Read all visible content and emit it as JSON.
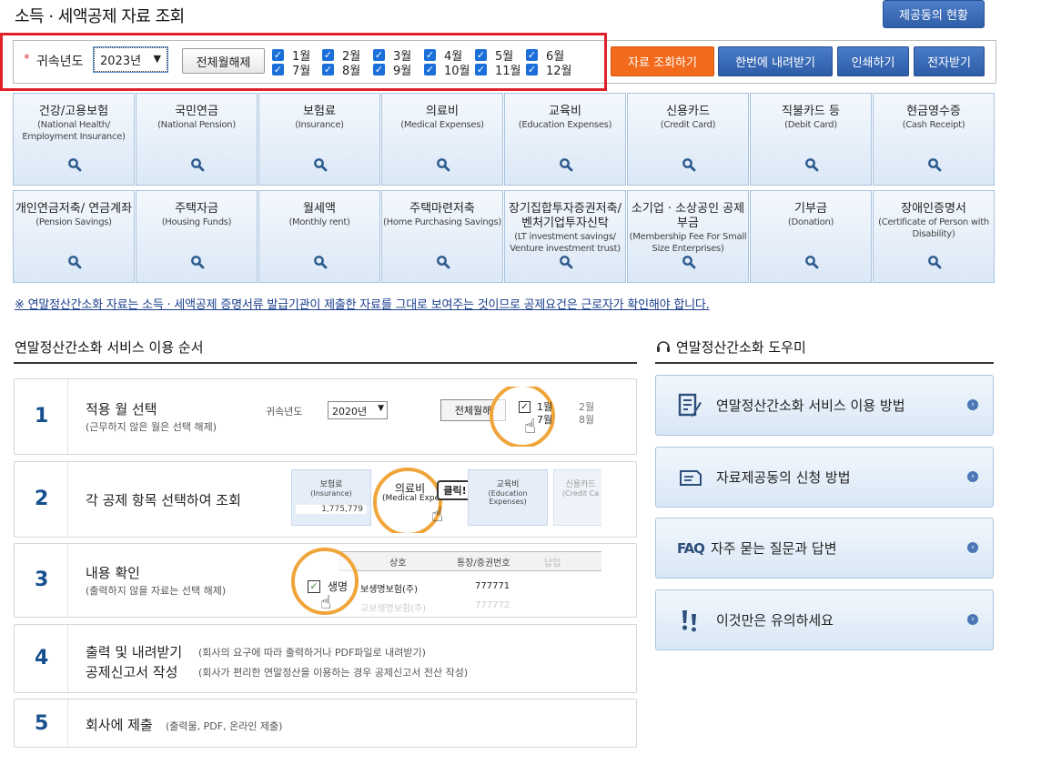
{
  "header": {
    "title": "소득 · 세액공제 자료 조회",
    "status_button": "제공동의 현황"
  },
  "filter": {
    "required_mark": "*",
    "year_label": "귀속년도",
    "year_value": "2023년",
    "uncheck_all": "전체월해제",
    "months": [
      "1월",
      "2월",
      "3월",
      "4월",
      "5월",
      "6월",
      "7월",
      "8월",
      "9월",
      "10월",
      "11월",
      "12월"
    ],
    "checked": [
      true,
      true,
      true,
      true,
      true,
      true,
      true,
      true,
      true,
      true,
      true,
      true
    ],
    "check_mark": "✓"
  },
  "actions": {
    "search": "자료 조회하기",
    "download_all": "한번에 내려받기",
    "print": "인쇄하기",
    "e_receive": "전자받기"
  },
  "categories": [
    {
      "kr": "건강/고용보험",
      "en": "(National Health/ Employment Insurance)"
    },
    {
      "kr": "국민연금",
      "en": "(National Pension)"
    },
    {
      "kr": "보험료",
      "en": "(Insurance)"
    },
    {
      "kr": "의료비",
      "en": "(Medical Expenses)"
    },
    {
      "kr": "교육비",
      "en": "(Education Expenses)"
    },
    {
      "kr": "신용카드",
      "en": "(Credit Card)"
    },
    {
      "kr": "직불카드 등",
      "en": "(Debit Card)"
    },
    {
      "kr": "현금영수증",
      "en": "(Cash Receipt)"
    },
    {
      "kr": "개인연금저축/ 연금계좌",
      "en": "(Pension Savings)"
    },
    {
      "kr": "주택자금",
      "en": "(Housing Funds)"
    },
    {
      "kr": "월세액",
      "en": "(Monthly rent)"
    },
    {
      "kr": "주택마련저축",
      "en": "(Home Purchasing Savings)"
    },
    {
      "kr": "장기집합투자증권저축/ 벤처기업투자신탁",
      "en": "(LT investment savings/ Venture investment trust)"
    },
    {
      "kr": "소기업 · 소상공인 공제부금",
      "en": "(Membership Fee For Small Size Enterprises)"
    },
    {
      "kr": "기부금",
      "en": "(Donation)"
    },
    {
      "kr": "장애인증명서",
      "en": "(Certificate of Person with Disability)"
    }
  ],
  "notice": "※ 연말정산간소화 자료는 소득 · 세액공제 증명서류 발급기관이 제출한 자료를 그대로 보여주는 것이므로 공제요건은 근로자가 확인해야 합니다.",
  "steps_section": {
    "title": "연말정산간소화 서비스 이용 순서",
    "steps": [
      {
        "num": "1",
        "title": "적용 월 선택",
        "sub": "(근무하지 않은 월은 선택 해제)"
      },
      {
        "num": "2",
        "title": "각 공제 항목 선택하여 조회",
        "sub": ""
      },
      {
        "num": "3",
        "title": "내용 확인",
        "sub": "(출력하지 않을 자료는 선택 해제)"
      },
      {
        "num": "4",
        "title": "출력 및 내려받기",
        "sub": "(회사의 요구에 따라 출력하거나 PDF파일로 내려받기)",
        "title2": "공제신고서 작성",
        "sub2": "(회사가 편리한 연말정산을 이용하는 경우 공제신고서 전산 작성)"
      },
      {
        "num": "5",
        "title": "회사에 제출",
        "sub": "(출력물, PDF, 온라인 제출)"
      }
    ],
    "illus1": {
      "year_label": "귀속년도",
      "year_value": "2020년",
      "uncheck": "전체월해",
      "m1": "1월",
      "m7": "7월",
      "m2": "2월",
      "m8": "8월"
    },
    "illus2": {
      "c1": "보험료",
      "c1en": "(Insurance)",
      "c1val": "1,775,779",
      "c2": "의료비",
      "c2en": "(Medical Expen",
      "click": "클릭!",
      "c3": "교육비",
      "c3en": "(Education Expenses)",
      "c4": "신용카드",
      "c4en": "(Credit Ca"
    },
    "illus3": {
      "h1": "상호",
      "h2": "통장/증권번호",
      "h3": "납입",
      "r1a": "생명",
      "r1b": "보생명보험(주)",
      "r1c": "777771",
      "r2": "교보생명보험(주)",
      "r2c": "777772"
    }
  },
  "helper": {
    "title": "연말정산간소화 도우미",
    "items": [
      {
        "label": "연말정산간소화 서비스 이용 방법",
        "icon": "document-pen-icon"
      },
      {
        "label": "자료제공동의 신청 방법",
        "icon": "document-icon"
      },
      {
        "label": "자주 묻는 질문과 답변",
        "icon": "faq-icon",
        "prefix": "FAQ"
      },
      {
        "label": "이것만은 유의하세요",
        "icon": "exclamation-icon"
      }
    ]
  }
}
